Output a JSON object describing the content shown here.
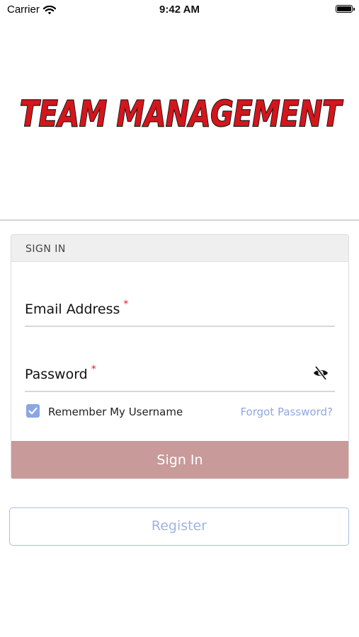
{
  "status_bar": {
    "carrier": "Carrier",
    "time": "9:42 AM",
    "wifi_icon": "wifi-icon",
    "battery_icon": "battery-icon"
  },
  "logo": {
    "text": "TEAM MANAGEMENT",
    "color": "#d4161c"
  },
  "sign_in": {
    "header": "SIGN IN",
    "email_label": "Email Address",
    "password_label": "Password",
    "required_marker": "*",
    "remember_label": "Remember My Username",
    "remember_checked": true,
    "forgot_link": "Forgot Password?",
    "sign_in_button": "Sign In",
    "visibility_icon": "eye-slash-icon"
  },
  "register_button": "Register",
  "colors": {
    "accent_blue": "#8aa6e4",
    "button_rose": "#c89a9a",
    "required_red": "#e0202a"
  }
}
